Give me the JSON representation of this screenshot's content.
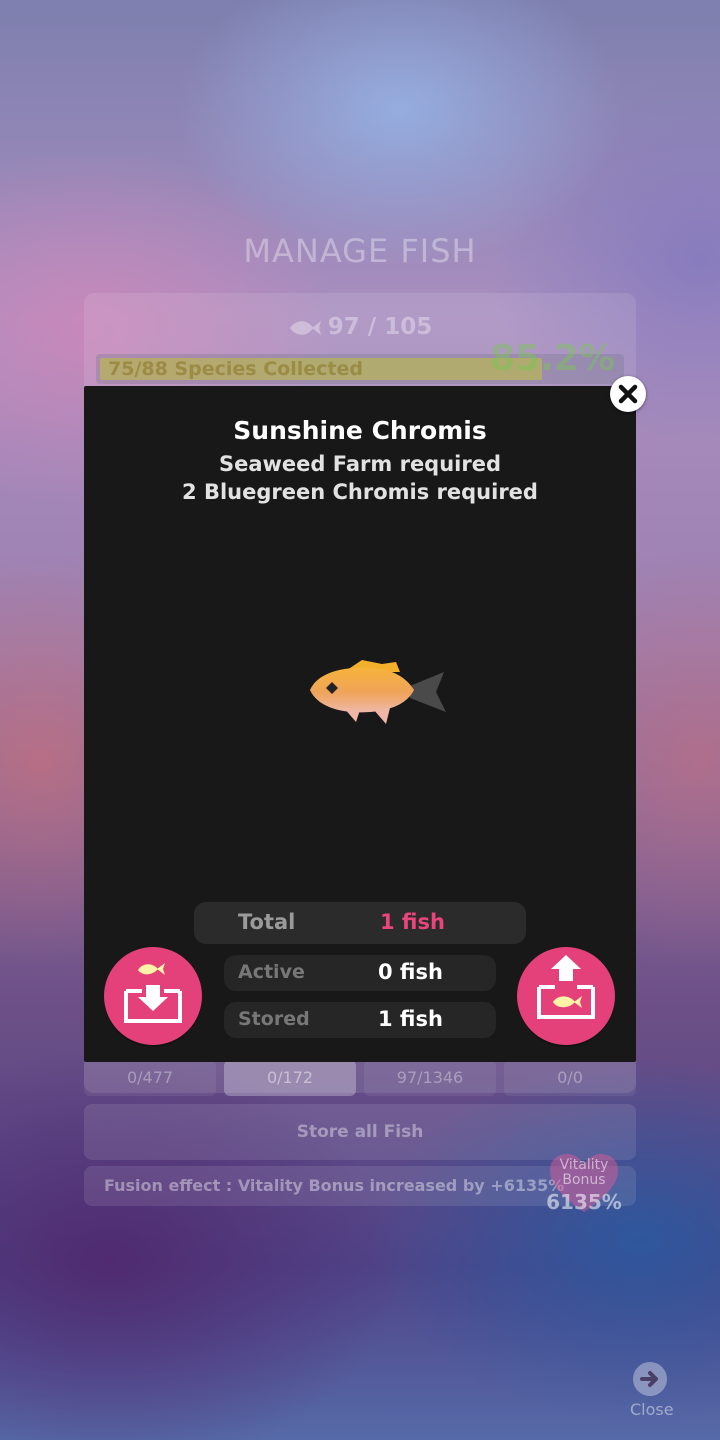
{
  "background": {
    "title": "MANAGE FISH",
    "fish_count": "97 / 105",
    "species_collected": "75/88 Species Collected",
    "species_fraction": 0.852,
    "collection_percent": "85.2%",
    "tabs": [
      {
        "label": "0/477",
        "active": false
      },
      {
        "label": "0/172",
        "active": true
      },
      {
        "label": "97/1346",
        "active": false
      },
      {
        "label": "0/0",
        "active": false
      }
    ],
    "store_all_label": "Store all Fish",
    "fusion_text": "Fusion effect : Vitality Bonus increased by +6135%",
    "vitality_label": "Vitality Bonus",
    "vitality_value": "6135%",
    "close_label": "Close"
  },
  "modal": {
    "title": "Sunshine Chromis",
    "requirements": [
      "Seaweed Farm required",
      "2 Bluegreen Chromis required"
    ],
    "stats": {
      "total_label": "Total",
      "total_value": "1 fish",
      "active_label": "Active",
      "active_value": "0 fish",
      "stored_label": "Stored",
      "stored_value": "1 fish"
    }
  },
  "icons": {
    "close": "close-icon",
    "store": "store-fish-icon",
    "release": "take-out-fish-icon",
    "fish": "fish-icon"
  },
  "colors": {
    "accent_pink": "#e4417a",
    "total_value": "#e9457d",
    "modal_bg": "#181818"
  }
}
